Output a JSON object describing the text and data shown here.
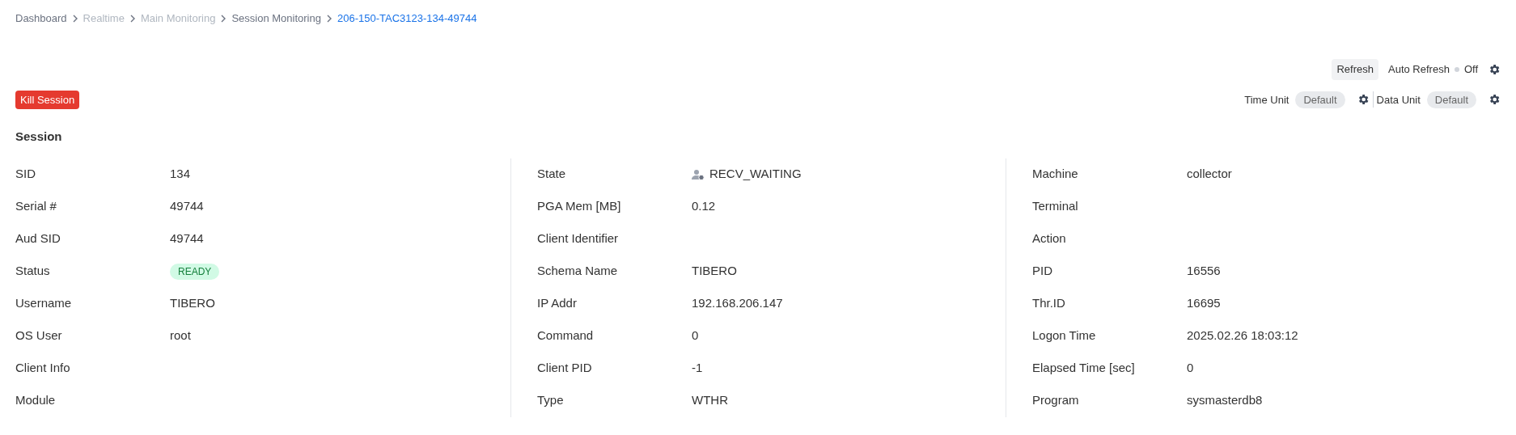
{
  "breadcrumb": [
    {
      "label": "Dashboard",
      "kind": "link"
    },
    {
      "label": "Realtime",
      "kind": "disabled"
    },
    {
      "label": "Main Monitoring",
      "kind": "disabled"
    },
    {
      "label": "Session Monitoring",
      "kind": "link"
    },
    {
      "label": "206-150-TAC3123-134-49744",
      "kind": "current"
    }
  ],
  "toolbar": {
    "refresh": "Refresh",
    "auto_refresh": {
      "label": "Auto Refresh",
      "on": false,
      "state": "Off"
    }
  },
  "kill_button": "Kill Session",
  "units": [
    {
      "label": "Time Unit",
      "value": "Default"
    },
    {
      "label": "Data Unit",
      "value": "Default"
    }
  ],
  "section_title": "Session",
  "columns": [
    [
      {
        "label": "SID",
        "value": "134",
        "kind": "text"
      },
      {
        "label": "Serial #",
        "value": "49744",
        "kind": "text"
      },
      {
        "label": "Aud SID",
        "value": "49744",
        "kind": "text"
      },
      {
        "label": "Status",
        "value": "READY",
        "kind": "badge"
      },
      {
        "label": "Username",
        "value": "TIBERO",
        "kind": "text"
      },
      {
        "label": "OS User",
        "value": "root",
        "kind": "text"
      },
      {
        "label": "Client Info"
      },
      {
        "label": "Module"
      }
    ],
    [
      {
        "label": "State",
        "value": "RECV_WAITING",
        "kind": "state"
      },
      {
        "label": "PGA Mem [MB]",
        "value": "0.12",
        "kind": "text"
      },
      {
        "label": "Client Identifier"
      },
      {
        "label": "Schema Name",
        "value": "TIBERO",
        "kind": "text"
      },
      {
        "label": "IP Addr",
        "value": "192.168.206.147",
        "kind": "text"
      },
      {
        "label": "Command",
        "value": "0",
        "kind": "text"
      },
      {
        "label": "Client PID",
        "value": "-1",
        "kind": "text"
      },
      {
        "label": "Type",
        "value": "WTHR",
        "kind": "text"
      }
    ],
    [
      {
        "label": "Machine",
        "value": "collector",
        "kind": "text"
      },
      {
        "label": "Terminal"
      },
      {
        "label": "Action"
      },
      {
        "label": "PID",
        "value": "16556",
        "kind": "text"
      },
      {
        "label": "Thr.ID",
        "value": "16695",
        "kind": "text"
      },
      {
        "label": "Logon Time",
        "value": "2025.02.26 18:03:12",
        "kind": "text"
      },
      {
        "label": "Elapsed Time [sec]",
        "value": "0",
        "kind": "text"
      },
      {
        "label": "Program",
        "value": "sysmasterdb8",
        "kind": "text"
      }
    ]
  ]
}
